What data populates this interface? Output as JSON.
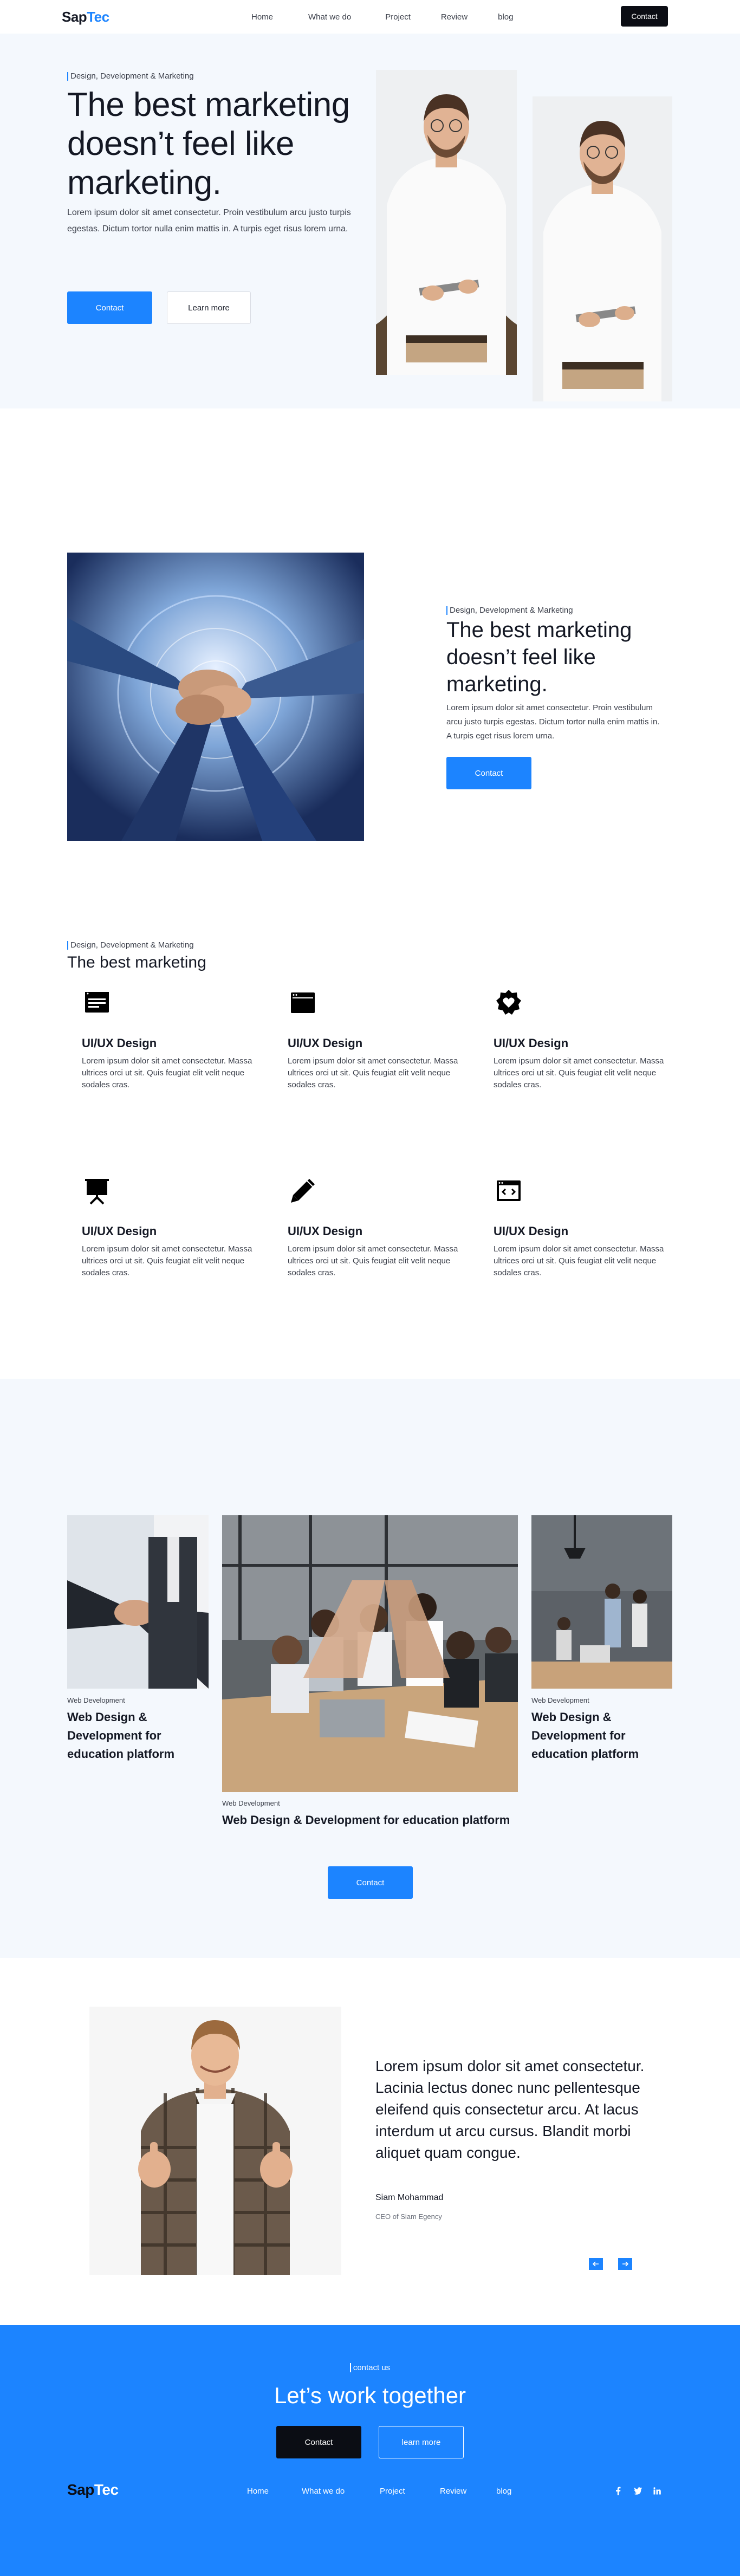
{
  "nav": {
    "brand_part1": "Sap",
    "brand_part2": "Tec",
    "links": [
      "Home",
      "What we do",
      "Project",
      "Review",
      "blog"
    ],
    "cta": "Contact"
  },
  "hero": {
    "tag": "Design, Development & Marketing",
    "title": "The best marketing doesn’t feel like marketing.",
    "lead": "Lorem ipsum dolor sit amet consectetur. Proin vestibulum arcu justo turpis egestas. Dictum tortor nulla enim mattis in. A turpis eget risus lorem urna.",
    "primary_button": "Contact",
    "secondary_button": "Learn more"
  },
  "about": {
    "tag": "Design, Development & Marketing",
    "title": "The best marketing doesn’t feel like marketing.",
    "lead": "Lorem ipsum dolor sit amet consectetur. Proin vestibulum arcu justo turpis egestas. Dictum tortor nulla enim mattis in. A turpis eget risus lorem urna.",
    "button": "Contact"
  },
  "services": {
    "tag": "Design, Development & Marketing",
    "title": "The best marketing",
    "items": [
      {
        "icon": "browser-window-icon",
        "title": "UI/UX Design",
        "text": "Lorem ipsum dolor sit amet consectetur. Massa ultrices orci ut sit. Quis feugiat elit velit neque sodales cras."
      },
      {
        "icon": "window-icon",
        "title": "UI/UX Design",
        "text": "Lorem ipsum dolor sit amet consectetur. Massa ultrices orci ut sit. Quis feugiat elit velit neque sodales cras."
      },
      {
        "icon": "heart-badge-icon",
        "title": "UI/UX Design",
        "text": "Lorem ipsum dolor sit amet consectetur. Massa ultrices orci ut sit. Quis feugiat elit velit neque sodales cras."
      },
      {
        "icon": "presentation-board-icon",
        "title": "UI/UX Design",
        "text": "Lorem ipsum dolor sit amet consectetur. Massa ultrices orci ut sit. Quis feugiat elit velit neque sodales cras."
      },
      {
        "icon": "pencil-icon",
        "title": "UI/UX Design",
        "text": "Lorem ipsum dolor sit amet consectetur. Massa ultrices orci ut sit. Quis feugiat elit velit neque sodales cras."
      },
      {
        "icon": "code-window-icon",
        "title": "UI/UX Design",
        "text": "Lorem ipsum dolor sit amet consectetur. Massa ultrices orci ut sit. Quis feugiat elit velit neque sodales cras."
      }
    ]
  },
  "projects": {
    "items": [
      {
        "tag": "Web Development",
        "title": "Web Design & Development for education platform"
      },
      {
        "tag": "Web Development",
        "title": "Web Design & Development for education platform"
      },
      {
        "tag": "Web Development",
        "title": "Web Design & Development for education platform"
      }
    ],
    "button": "Contact"
  },
  "testimonial": {
    "quote": "Lorem ipsum dolor sit amet consectetur. Lacinia lectus donec nunc pellentesque eleifend quis consectetur arcu. At lacus interdum ut arcu cursus. Blandit morbi aliquet quam congue.",
    "name": "Siam Mohammad",
    "role": "CEO of Siam Egency"
  },
  "footer": {
    "tag": "contact us",
    "title": "Let’s work together",
    "primary_button": "Contact",
    "secondary_button": "learn more",
    "brand_part1": "Sap",
    "brand_part2": "Tec",
    "links": [
      "Home",
      "What we do",
      "Project",
      "Review",
      "blog"
    ],
    "social": [
      "facebook-icon",
      "twitter-icon",
      "linkedin-icon"
    ]
  },
  "colors": {
    "accent": "#1c84ff",
    "dark": "#0b0d14",
    "light_bg": "#f4f8fd"
  }
}
